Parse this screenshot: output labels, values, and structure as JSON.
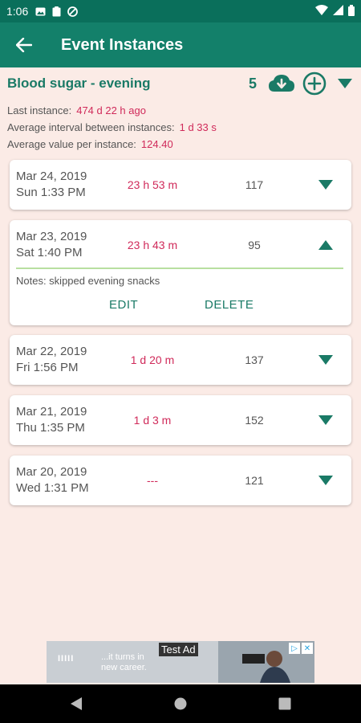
{
  "status": {
    "time": "1:06"
  },
  "appbar": {
    "title": "Event Instances"
  },
  "event": {
    "name": "Blood sugar - evening",
    "count": "5"
  },
  "stats": {
    "last_label": "Last instance:",
    "last_value": "474 d 22 h ago",
    "avg_interval_label": "Average interval between instances:",
    "avg_interval_value": "1 d 33 s",
    "avg_value_label": "Average value per instance:",
    "avg_value_value": "124.40"
  },
  "instances": [
    {
      "date": "Mar 24, 2019",
      "time": "Sun 1:33 PM",
      "interval": "23 h 53 m",
      "value": "117",
      "expanded": false
    },
    {
      "date": "Mar 23, 2019",
      "time": "Sat 1:40 PM",
      "interval": "23 h 43 m",
      "value": "95",
      "expanded": true,
      "notes": "Notes: skipped evening snacks",
      "edit_label": "EDIT",
      "delete_label": "DELETE"
    },
    {
      "date": "Mar 22, 2019",
      "time": "Fri 1:56 PM",
      "interval": "1 d 20 m",
      "value": "137",
      "expanded": false
    },
    {
      "date": "Mar 21, 2019",
      "time": "Thu 1:35 PM",
      "interval": "1 d 3 m",
      "value": "152",
      "expanded": false
    },
    {
      "date": "Mar 20, 2019",
      "time": "Wed 1:31 PM",
      "interval": "---",
      "value": "121",
      "expanded": false
    }
  ],
  "ad": {
    "label": "Test Ad",
    "logo": "IIIII",
    "line1": "...it turns in",
    "line2": "new career."
  },
  "colors": {
    "primary": "#13806a",
    "primary_dark": "#0a6f5b",
    "accent_text": "#1a7a66",
    "interval": "#d02a5a",
    "background": "#fbebe6"
  },
  "icons": {
    "back": "arrow-left-icon",
    "download": "cloud-download-icon",
    "add": "plus-circle-icon",
    "collapse": "triangle-down-icon",
    "expand": "triangle-up-icon"
  }
}
